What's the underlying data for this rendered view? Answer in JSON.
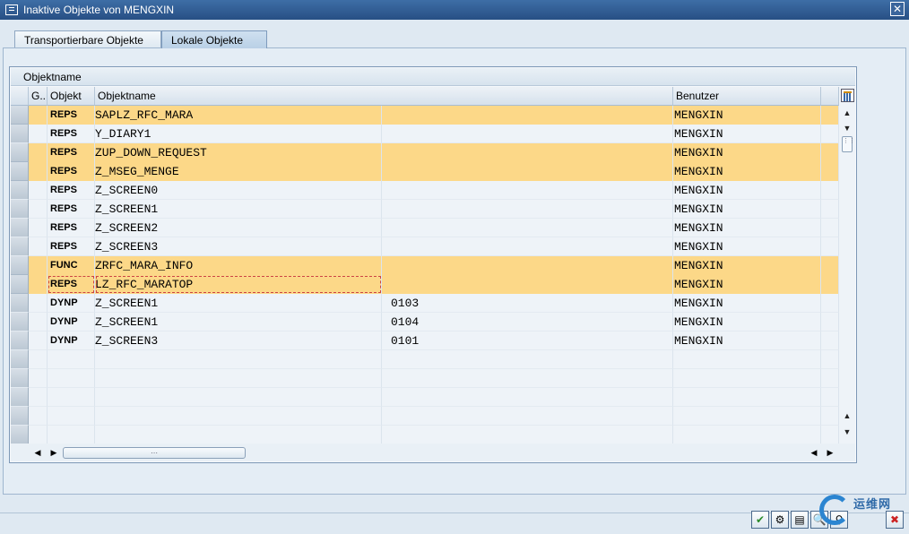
{
  "window": {
    "title": "Inaktive Objekte von MENGXIN"
  },
  "tabs": [
    {
      "label": "Transportierbare Objekte",
      "active": false
    },
    {
      "label": "Lokale Objekte",
      "active": true
    }
  ],
  "grid": {
    "title": "Objektname",
    "columns": [
      "G..",
      "Objekt",
      "Objektname",
      "Benutzer"
    ],
    "rows": [
      {
        "objekt": "REPS",
        "name": "SAPLZ_RFC_MARA",
        "extra": "",
        "user": "MENGXIN",
        "highlight": true
      },
      {
        "objekt": "REPS",
        "name": "Y_DIARY1",
        "extra": "",
        "user": "MENGXIN",
        "highlight": false
      },
      {
        "objekt": "REPS",
        "name": "ZUP_DOWN_REQUEST",
        "extra": "",
        "user": "MENGXIN",
        "highlight": true
      },
      {
        "objekt": "REPS",
        "name": "Z_MSEG_MENGE",
        "extra": "",
        "user": "MENGXIN",
        "highlight": true
      },
      {
        "objekt": "REPS",
        "name": "Z_SCREEN0",
        "extra": "",
        "user": "MENGXIN",
        "highlight": false
      },
      {
        "objekt": "REPS",
        "name": "Z_SCREEN1",
        "extra": "",
        "user": "MENGXIN",
        "highlight": false
      },
      {
        "objekt": "REPS",
        "name": "Z_SCREEN2",
        "extra": "",
        "user": "MENGXIN",
        "highlight": false
      },
      {
        "objekt": "REPS",
        "name": "Z_SCREEN3",
        "extra": "",
        "user": "MENGXIN",
        "highlight": false
      },
      {
        "objekt": "FUNC",
        "name": "ZRFC_MARA_INFO",
        "extra": "",
        "user": "MENGXIN",
        "highlight": true
      },
      {
        "objekt": "REPS",
        "name": "LZ_RFC_MARATOP",
        "extra": "",
        "user": "MENGXIN",
        "highlight": true,
        "focused": true
      },
      {
        "objekt": "DYNP",
        "name": "Z_SCREEN1",
        "extra": "0103",
        "user": "MENGXIN",
        "highlight": false
      },
      {
        "objekt": "DYNP",
        "name": "Z_SCREEN1",
        "extra": "0104",
        "user": "MENGXIN",
        "highlight": false
      },
      {
        "objekt": "DYNP",
        "name": "Z_SCREEN3",
        "extra": "0101",
        "user": "MENGXIN",
        "highlight": false
      }
    ],
    "empty_rows": 5
  },
  "footer": {
    "buttons": [
      {
        "name": "confirm-button",
        "glyph": "✔"
      },
      {
        "name": "activate-button",
        "glyph": "⚙"
      },
      {
        "name": "display-button",
        "glyph": "▤"
      },
      {
        "name": "find-button",
        "glyph": "🔍"
      },
      {
        "name": "find-next-button",
        "glyph": "⚲"
      },
      {
        "name": "cancel-button",
        "glyph": "✖"
      }
    ]
  },
  "watermark": {
    "text": "运维网"
  }
}
